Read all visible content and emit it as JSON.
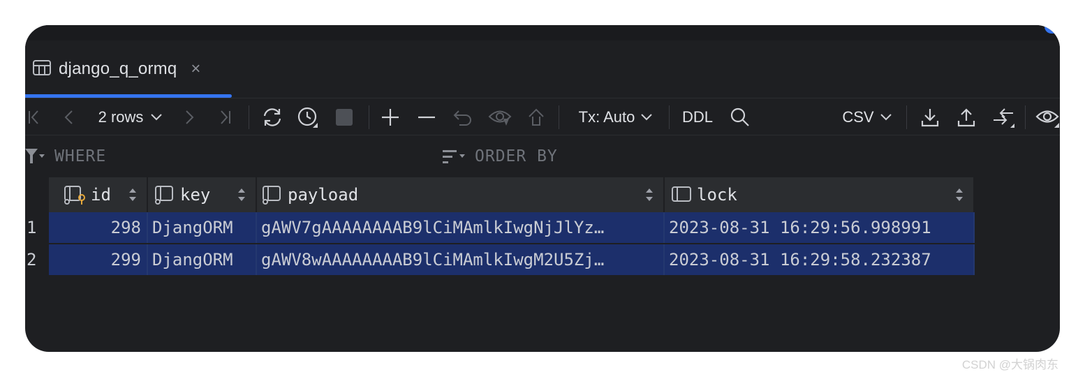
{
  "tab": {
    "title": "django_q_ormq",
    "close": "×"
  },
  "toolbar": {
    "rows": "2 rows",
    "tx": "Tx: Auto",
    "ddl": "DDL",
    "export_format": "CSV"
  },
  "filter": {
    "where": "WHERE",
    "order_by": "ORDER BY"
  },
  "table": {
    "columns": [
      "id",
      "key",
      "payload",
      "lock"
    ],
    "rows": [
      {
        "num": "1",
        "id": "298",
        "key": "DjangORM",
        "payload": "gAWV7gAAAAAAAAB9lCiMAmlkIwgNjJlYz…",
        "lock": "2023-08-31 16:29:56.998991"
      },
      {
        "num": "2",
        "id": "299",
        "key": "DjangORM",
        "payload": "gAWV8wAAAAAAAAB9lCiMAmlkIwgM2U5Zj…",
        "lock": "2023-08-31 16:29:58.232387"
      }
    ]
  },
  "watermark": "CSDN @大锅肉东",
  "colors": {
    "accent": "#3574f0",
    "selection": "#1c2f6b",
    "background": "#1e1f22",
    "header": "#2b2d30"
  }
}
